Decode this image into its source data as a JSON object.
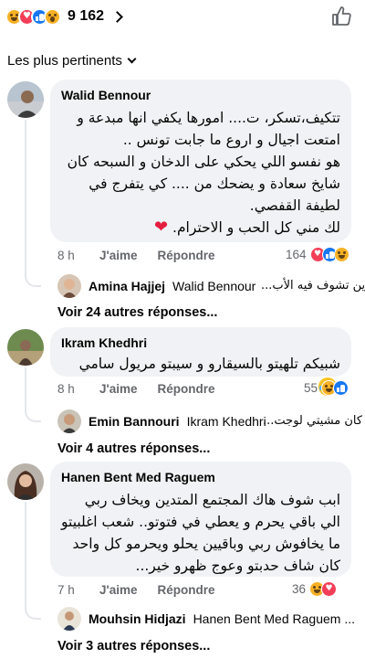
{
  "header": {
    "reaction_icons": [
      "haha-reaction-icon",
      "love-reaction-icon",
      "like-reaction-icon",
      "wow-reaction-icon"
    ],
    "reaction_count": "9 162",
    "sort_label": "Les plus pertinents"
  },
  "comments": [
    {
      "author": "Walid Bennour",
      "text": "تتكيف،تسكر، ت.... امورها يكفي انها مبدعة و امتعت اجيال و اروع ما جابت تونس ..\nهو نفسو اللي يحكي على الدخان و السبحه كان شايخ سعادة و يضحك من .... كي يتفرج في لطيفة القفصي.\nلك مني كل الحب و الاحترام.",
      "time": "8 h",
      "like_label": "J'aime",
      "reply_label": "Répondre",
      "reaction_count": "164",
      "reply_author": "Amina Hajjej",
      "reply_tag": "Walid Bennour",
      "reply_text": "وين تشوف فيه الأب...",
      "more_replies": "Voir 24 autres réponses..."
    },
    {
      "author": "Ikram Khedhri",
      "text": "شبيكم تلهيتو بالسيقارو و سيبتو مريول سامي",
      "time": "8 h",
      "like_label": "J'aime",
      "reply_label": "Répondre",
      "reaction_count": "55",
      "reply_author": "Emin Bannouri",
      "reply_tag": "Ikram Khedhri",
      "reply_text": "كان مشيتي لوجت...",
      "more_replies": "Voir 4 autres réponses..."
    },
    {
      "author": "Hanen Bent Med Raguem",
      "text": "ابب شوف هاك المجتمع المتدين ويخاف ربي الي باقي يحرم و يعطي في فتوتو.. شعب اغلبيتو ما يخافوش ربي وباقيين يحلو ويحرمو كل واحد كان شاف حدبتو وعوج ظهرو خير...",
      "time": "7 h",
      "like_label": "J'aime",
      "reply_label": "Répondre",
      "reaction_count": "36",
      "reply_author": "Mouhsin Hidjazi",
      "reply_tag": "Hanen Bent Med Raguem ...",
      "reply_text": "",
      "more_replies": "Voir 3 autres réponses..."
    }
  ],
  "colors": {
    "bubble": "#f0f2f5",
    "meta_text": "#65676b",
    "like_blue": "#1877f2",
    "love_red": "#f33e58",
    "haha_yellow": "#f7b125"
  }
}
